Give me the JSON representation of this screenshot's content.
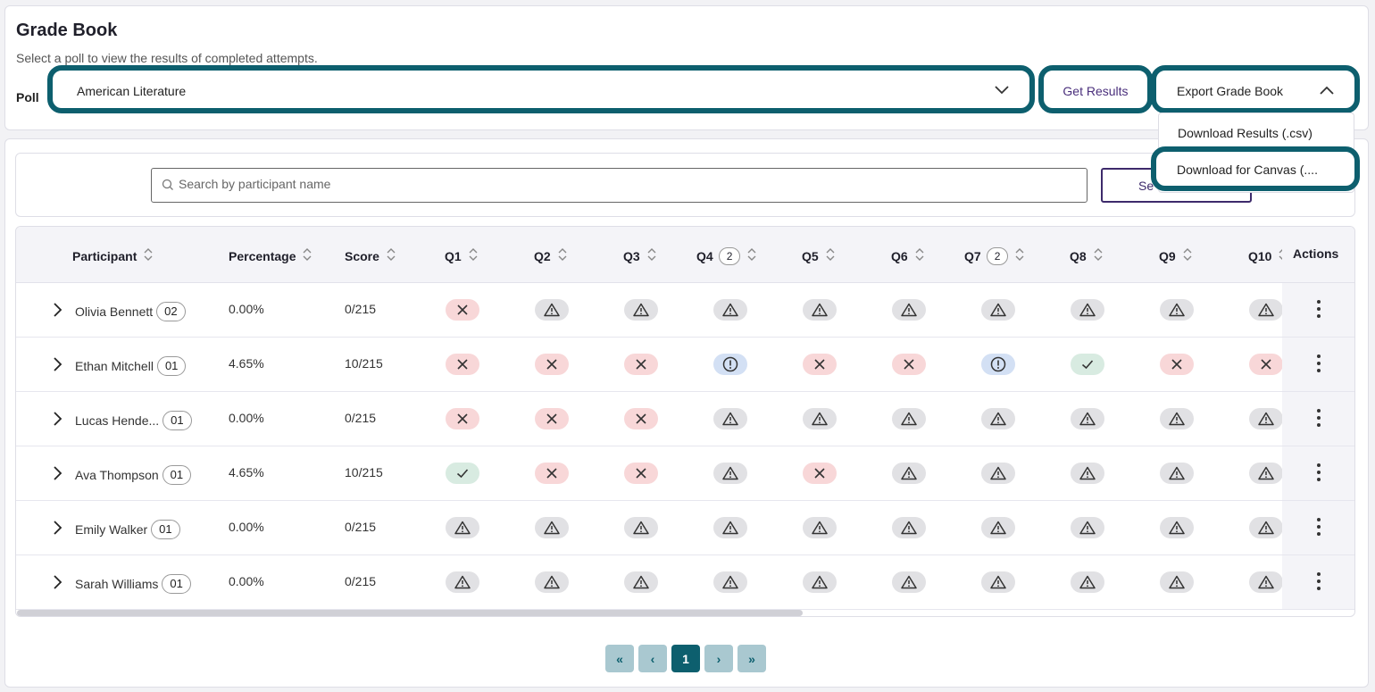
{
  "header": {
    "title": "Grade Book",
    "subtitle": "Select a poll to view the results of completed attempts.",
    "poll_label": "Poll",
    "poll_selected": "American Literature",
    "get_results_label": "Get Results",
    "export_label": "Export Grade Book",
    "export_menu": [
      "Download Results (.csv)",
      "Download for Canvas (...."
    ]
  },
  "search": {
    "placeholder": "Search by participant name",
    "button_label": "Se"
  },
  "table": {
    "columns": {
      "participant": "Participant",
      "percentage": "Percentage",
      "score": "Score",
      "actions": "Actions"
    },
    "questions": [
      {
        "label": "Q1",
        "count": ""
      },
      {
        "label": "Q2",
        "count": ""
      },
      {
        "label": "Q3",
        "count": ""
      },
      {
        "label": "Q4",
        "count": "2"
      },
      {
        "label": "Q5",
        "count": ""
      },
      {
        "label": "Q6",
        "count": ""
      },
      {
        "label": "Q7",
        "count": "2"
      },
      {
        "label": "Q8",
        "count": ""
      },
      {
        "label": "Q9",
        "count": ""
      },
      {
        "label": "Q10",
        "count": ""
      }
    ],
    "rows": [
      {
        "name": "Olivia Bennett",
        "attempts": "02",
        "percentage": "0.00%",
        "score": "0/215",
        "results": [
          "wrong",
          "nr",
          "nr",
          "nr",
          "nr",
          "nr",
          "nr",
          "nr",
          "nr",
          "nr"
        ]
      },
      {
        "name": "Ethan Mitchell",
        "attempts": "01",
        "percentage": "4.65%",
        "score": "10/215",
        "results": [
          "wrong",
          "wrong",
          "wrong",
          "partial",
          "wrong",
          "wrong",
          "partial",
          "correct",
          "wrong",
          "wrong"
        ]
      },
      {
        "name": "Lucas Hende...",
        "attempts": "01",
        "percentage": "0.00%",
        "score": "0/215",
        "results": [
          "wrong",
          "wrong",
          "wrong",
          "nr",
          "nr",
          "nr",
          "nr",
          "nr",
          "nr",
          "nr"
        ]
      },
      {
        "name": "Ava Thompson",
        "attempts": "01",
        "percentage": "4.65%",
        "score": "10/215",
        "results": [
          "correct",
          "wrong",
          "wrong",
          "nr",
          "wrong",
          "nr",
          "nr",
          "nr",
          "nr",
          "nr"
        ]
      },
      {
        "name": "Emily Walker",
        "attempts": "01",
        "percentage": "0.00%",
        "score": "0/215",
        "results": [
          "nr",
          "nr",
          "nr",
          "nr",
          "nr",
          "nr",
          "nr",
          "nr",
          "nr",
          "nr"
        ]
      },
      {
        "name": "Sarah Williams",
        "attempts": "01",
        "percentage": "0.00%",
        "score": "0/215",
        "results": [
          "nr",
          "nr",
          "nr",
          "nr",
          "nr",
          "nr",
          "nr",
          "nr",
          "nr",
          "nr"
        ]
      }
    ]
  },
  "pagination": {
    "first": "«",
    "prev": "‹",
    "current": "1",
    "next": "›",
    "last": "»"
  },
  "colors": {
    "accent": "#0d5f6e",
    "wrong_bg": "#f8d7d8",
    "no_response_bg": "#e1e1e4",
    "partial_bg": "#d3e0f4",
    "correct_bg": "#d8ebe1"
  }
}
